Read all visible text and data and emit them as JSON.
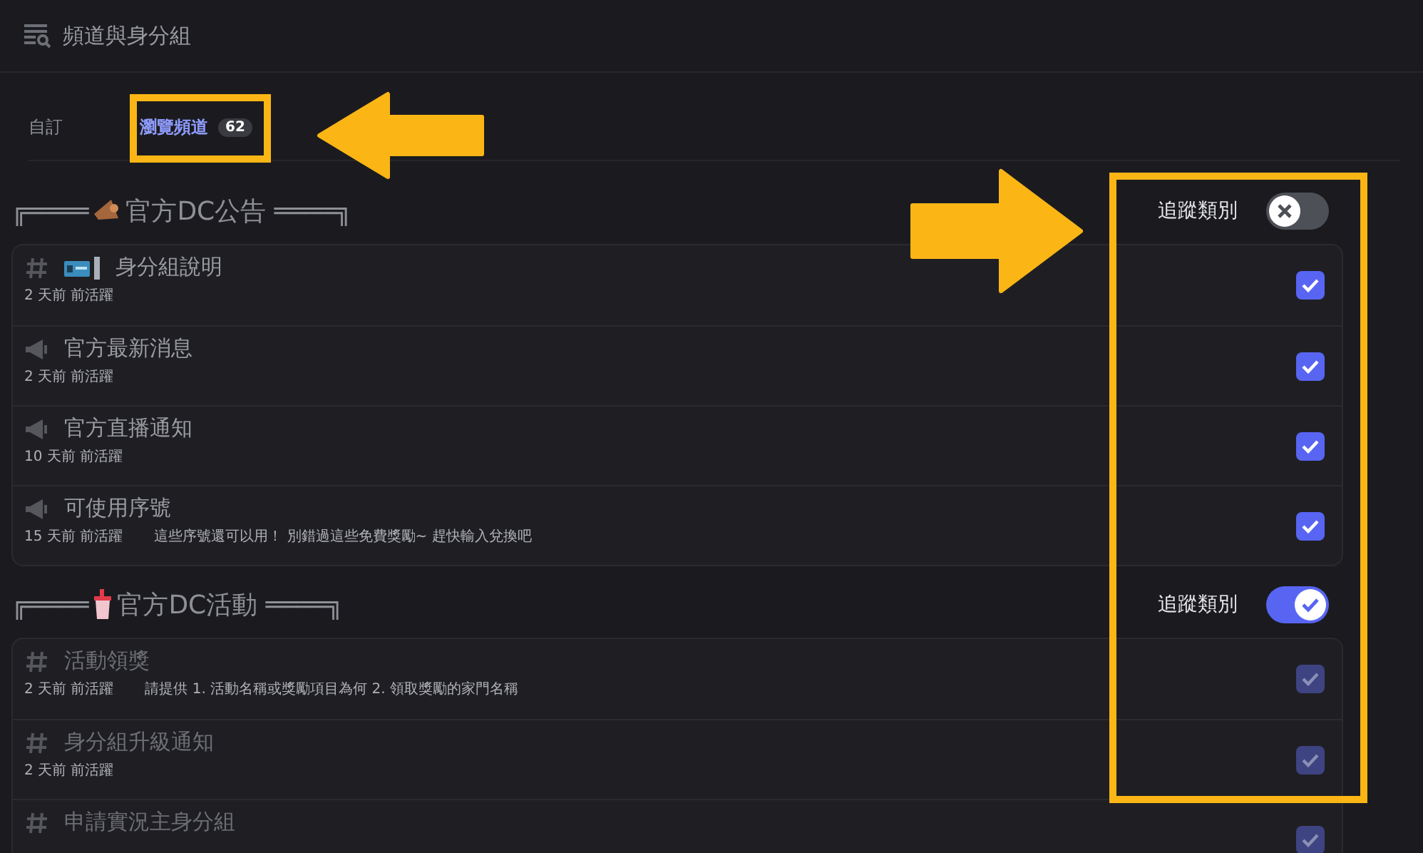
{
  "header": {
    "title": "頻道與身分組"
  },
  "tabs": [
    {
      "label": "自訂",
      "selected": false
    },
    {
      "label": "瀏覽頻道",
      "selected": true,
      "count": "62"
    }
  ],
  "categories": [
    {
      "prefix": "╔════",
      "kind": "announcements",
      "name": "官方DC公告",
      "suffix": "════╗",
      "follow_label": "追蹤類別",
      "follow_on": false,
      "channels": [
        {
          "kind": "text",
          "badge": true,
          "name": "身分組說明",
          "activity": "2 天前 前活躍",
          "checked": true,
          "dimmed": false
        },
        {
          "kind": "announcement",
          "name": "官方最新消息",
          "activity": "2 天前 前活躍",
          "checked": true,
          "dimmed": false
        },
        {
          "kind": "announcement",
          "name": "官方直播通知",
          "activity": "10 天前 前活躍",
          "checked": true,
          "dimmed": false
        },
        {
          "kind": "announcement",
          "name": "可使用序號",
          "activity": "15 天前 前活躍",
          "topic": "這些序號還可以用！ 別錯過這些免費獎勵~ 趕快輸入兌換吧",
          "checked": true,
          "dimmed": false
        }
      ]
    },
    {
      "prefix": "╔════",
      "kind": "events",
      "name": "官方DC活動",
      "suffix": "════╗",
      "follow_label": "追蹤類別",
      "follow_on": true,
      "channels": [
        {
          "kind": "text",
          "name": "活動領獎",
          "activity": "2 天前 前活躍",
          "topic": "請提供 1. 活動名稱或獎勵項目為何 2. 領取獎勵的家門名稱",
          "checked": true,
          "dimmed": true
        },
        {
          "kind": "text",
          "name": "身分組升級通知",
          "activity": "2 天前 前活躍",
          "checked": true,
          "dimmed": true
        },
        {
          "kind": "text",
          "name": "申請實況主身分組",
          "checked": true,
          "dimmed": true
        }
      ]
    }
  ]
}
